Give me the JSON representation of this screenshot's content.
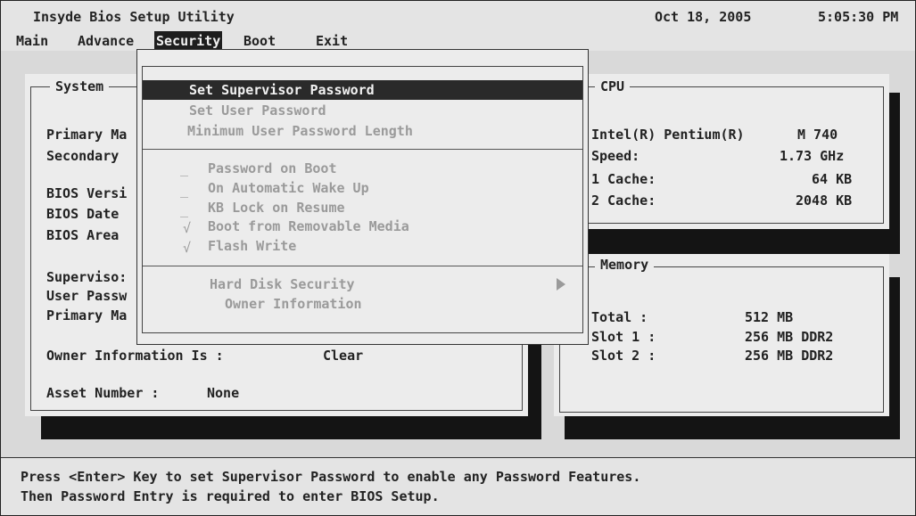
{
  "title": {
    "app": "Insyde Bios Setup Utility",
    "date": "Oct 18, 2005",
    "time": "5:05:30 PM"
  },
  "menu": [
    "Main",
    "Advance",
    "Security",
    "Boot",
    "Exit"
  ],
  "selected_menu": "Security",
  "system_panel": {
    "title": "System",
    "labels": [
      "Primary Ma",
      "Secondary",
      "BIOS Versi",
      "BIOS Date",
      "BIOS Area",
      "Superviso:",
      "User Passw",
      "Primary Ma"
    ],
    "owner_info_label": "Owner Information Is :",
    "owner_info_value": "Clear",
    "asset_label": "Asset Number :",
    "asset_value": "None"
  },
  "cpu_panel": {
    "title": "CPU",
    "model": "Intel(R) Pentium(R)",
    "model_num": "M 740",
    "speed_label": "Speed:",
    "speed_value": "1.73 GHz",
    "l1_label": "1 Cache:",
    "l1_value": "64 KB",
    "l2_label": "2 Cache:",
    "l2_value": "2048 KB"
  },
  "memory_panel": {
    "title": "Memory",
    "total_label": "Total :",
    "total_value": "512 MB",
    "slot1_label": "Slot 1 :",
    "slot1_value": "256 MB DDR2",
    "slot2_label": "Slot 2 :",
    "slot2_value": "256 MB DDR2"
  },
  "dropdown": {
    "set_supervisor": "Set Supervisor Password",
    "set_user": "Set User Password",
    "min_length": "Minimum User Password Length",
    "password_on_boot": "Password on Boot",
    "auto_wake": "On Automatic Wake Up",
    "kb_lock": "KB Lock on Resume",
    "boot_removable": "Boot from Removable Media",
    "flash_write": "Flash Write",
    "hdd_security": "Hard Disk Security",
    "owner_info": "Owner Information",
    "unchecked_mark": "_",
    "checked_mark": "√"
  },
  "help": {
    "line1": "Press <Enter> Key to set Supervisor Password to enable any Password Features.",
    "line2": "Then Password Entry is required to enter BIOS Setup."
  }
}
